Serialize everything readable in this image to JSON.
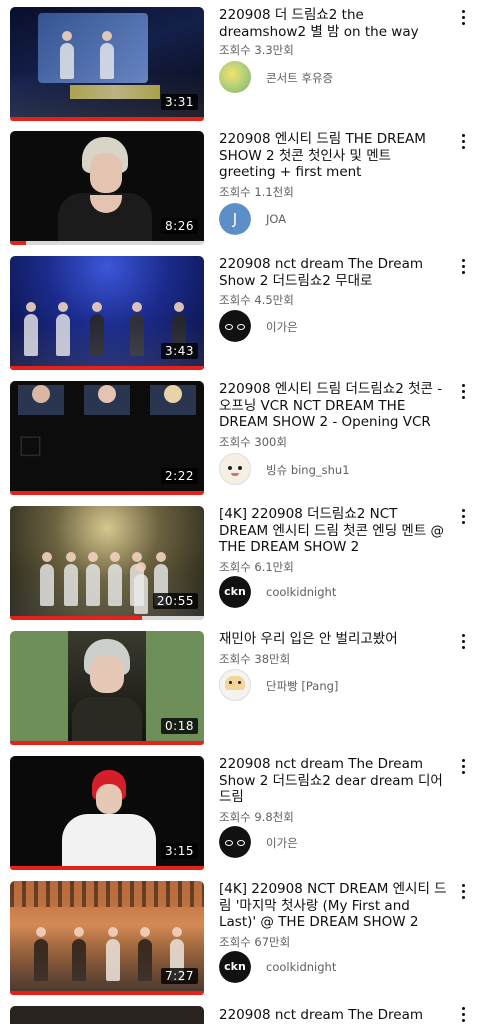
{
  "videos": [
    {
      "title": "220908 더 드림쇼2 the dreamshow2 별 밤 on the way",
      "views": "조회수 3.3만회",
      "channel": "콘서트 후유증",
      "duration": "3:31",
      "progress": 1.0,
      "avatar_icon": "landscape-avatar-icon"
    },
    {
      "title": "220908 엔시티 드림 THE DREAM SHOW 2 첫콘 첫인사 및 멘트 greeting + first ment",
      "views": "조회수 1.1천회",
      "channel": "JOA",
      "duration": "8:26",
      "progress": 0.08,
      "avatar_letter": "J"
    },
    {
      "title": "220908 nct dream The Dream Show 2 더드림쇼2 무대로",
      "views": "조회수 4.5만회",
      "channel": "이가은",
      "duration": "3:43",
      "progress": 1.0,
      "avatar_icon": "eyes-avatar-icon"
    },
    {
      "title": "220908 엔시티 드림  더드림쇼2  첫콘 - 오프닝 VCR NCT DREAM THE DREAM SHOW 2 - Opening VCR",
      "views": "조회수 300회",
      "channel": "빙슈 bing_shu1",
      "duration": "2:22",
      "progress": 1.0,
      "avatar_icon": "cartoon-avatar-icon"
    },
    {
      "title": "[4K] 220908 더드림쇼2 NCT DREAM 엔시티 드림 첫콘 엔딩 멘트 @ THE DREAM SHOW 2",
      "views": "조회수 6.1만회",
      "channel": "coolkidnight",
      "duration": "20:55",
      "progress": 0.68,
      "avatar_text": "ckn"
    },
    {
      "title": "재민아 우리 입은 안 벌리고봤어",
      "views": "조회수 38만회",
      "channel": "단파빵 [Pang]",
      "duration": "0:18",
      "progress": 1.0,
      "avatar_icon": "bread-avatar-icon"
    },
    {
      "title": "220908 nct dream The Dream Show 2  더드림쇼2 dear dream 디어드림",
      "views": "조회수 9.8천회",
      "channel": "이가은",
      "duration": "3:15",
      "progress": 1.0,
      "avatar_icon": "eyes-avatar-icon"
    },
    {
      "title": "[4K] 220908 NCT DREAM 엔시티 드림 '마지막 첫사랑 (My First and Last)' @ THE DREAM SHOW 2",
      "views": "조회수 67만회",
      "channel": "coolkidnight",
      "duration": "7:27",
      "progress": 1.0,
      "avatar_text": "ckn"
    }
  ],
  "next_peek": {
    "title": "220908 nct dream The Dream"
  },
  "colors": {
    "progress": "#e62117",
    "meta": "#606060",
    "title": "#0f0f0f"
  }
}
